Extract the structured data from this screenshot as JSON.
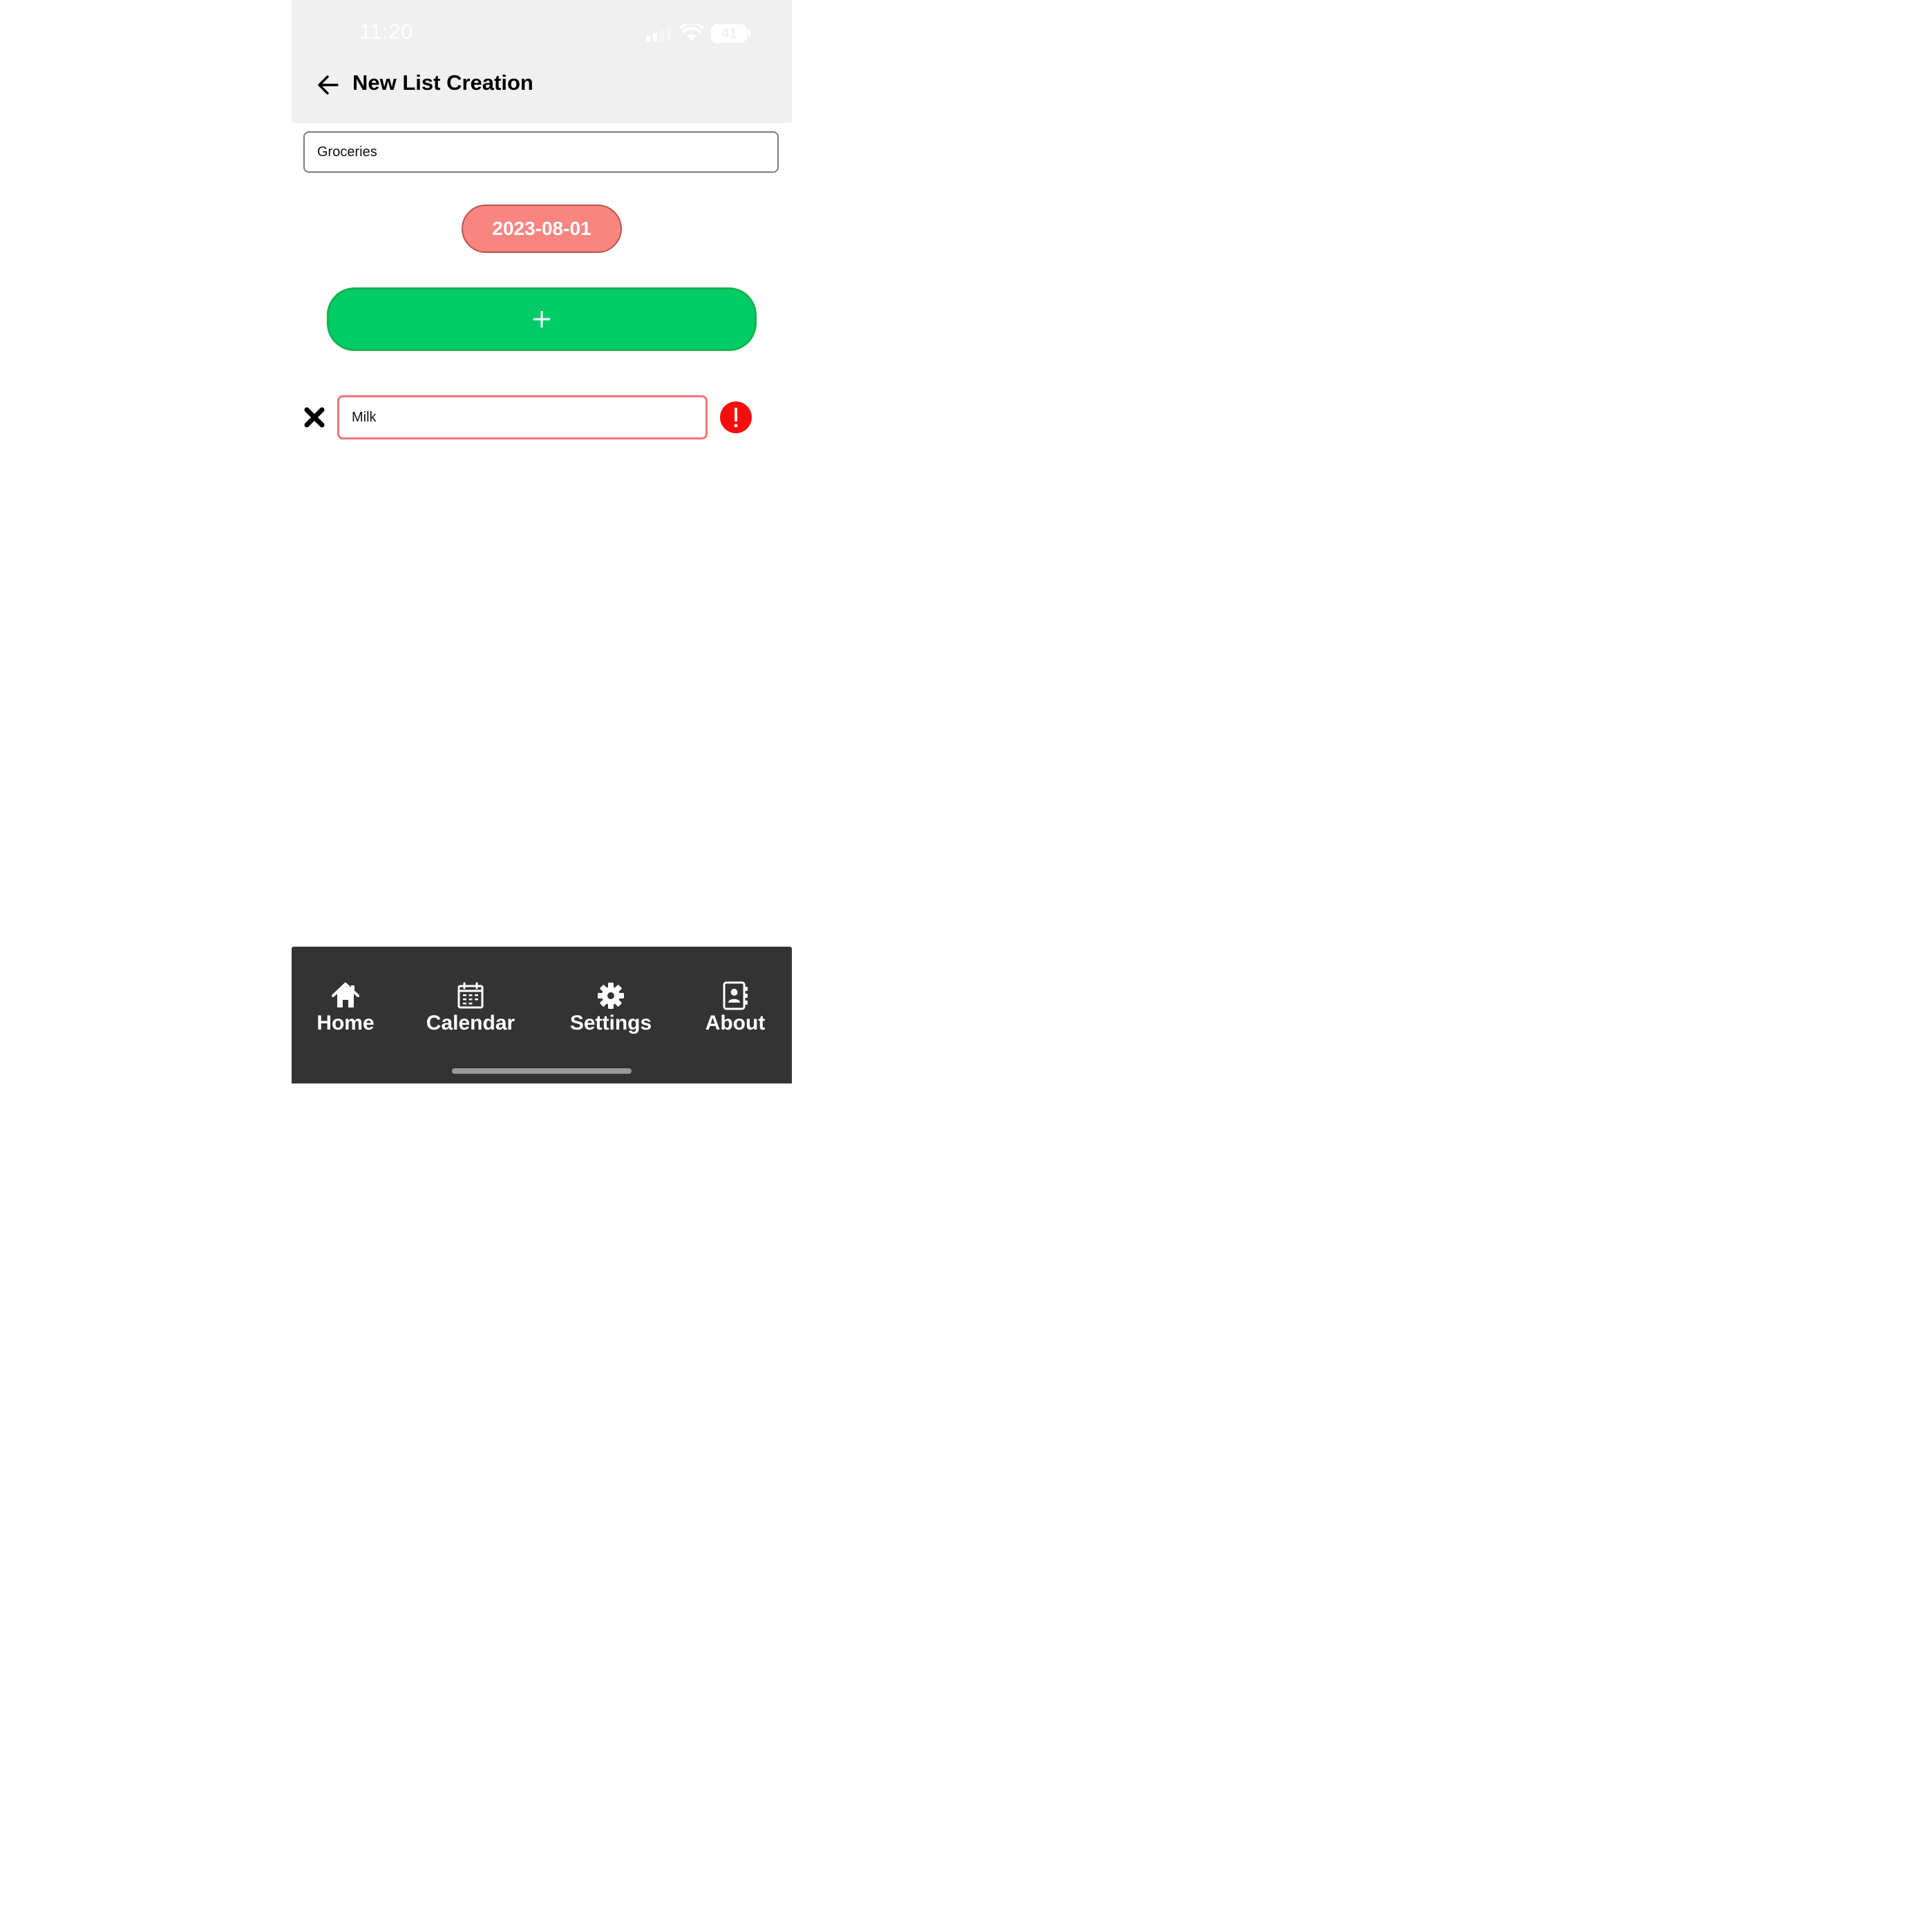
{
  "status_bar": {
    "time": "11:20",
    "battery": "41"
  },
  "header": {
    "title": "New List Creation",
    "back_icon": "arrow-left-icon"
  },
  "list_name_input": {
    "value": "Groceries"
  },
  "date_button": {
    "label": "2023-08-01",
    "color": "#f98580"
  },
  "add_item_button": {
    "label": "+",
    "color": "#00cc67"
  },
  "items": [
    {
      "value": "Milk",
      "delete_icon": "x-mark-icon",
      "status_icon": "error-exclamation-icon",
      "border_color": "#f07474"
    }
  ],
  "tab_bar": {
    "background": "#333333",
    "tabs": [
      {
        "label": "Home",
        "icon": "house-icon"
      },
      {
        "label": "Calendar",
        "icon": "calendar-icon"
      },
      {
        "label": "Settings",
        "icon": "gear-icon"
      },
      {
        "label": "About",
        "icon": "contact-book-icon"
      }
    ]
  }
}
